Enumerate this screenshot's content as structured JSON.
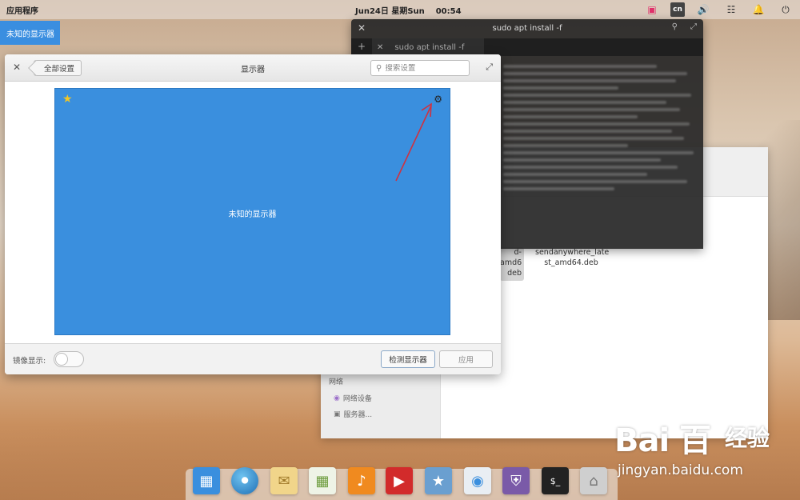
{
  "top_panel": {
    "apps_label": "应用程序",
    "clock": "Jun24日 星期Sun    00:54",
    "input_method": "cn"
  },
  "blue_tag": "未知的显示器",
  "terminal": {
    "title": "sudo apt install -f",
    "tab_label": "sudo apt install -f"
  },
  "file_manager": {
    "section_network": "网络",
    "items": [
      "网络设备",
      "服务器..."
    ],
    "file_name": "sendanywhere_late st_amd64.deb",
    "file_name_partial": "d- amd6 deb"
  },
  "settings": {
    "back_label": "全部设置",
    "title": "显示器",
    "search_placeholder": "搜索设置",
    "monitor_label": "未知的显示器",
    "mirror_label": "镜像显示:",
    "detect_button": "检测显示器",
    "apply_button": "应用"
  },
  "dock": [
    "multitasking-view",
    "browser",
    "mail",
    "calendar",
    "music",
    "videos",
    "photos",
    "system-settings",
    "app-center",
    "terminal",
    "files"
  ],
  "watermark": {
    "logo": "Bai 百",
    "cn": "经验",
    "url": "jingyan.baidu.com"
  },
  "colors": {
    "accent_blue": "#3a8fde",
    "star": "#f3c623",
    "arrow": "#d0313f"
  }
}
